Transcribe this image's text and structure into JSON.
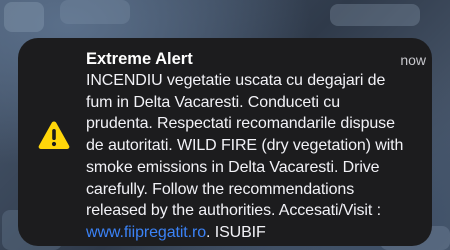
{
  "notification": {
    "title": "Extreme Alert",
    "time": "now",
    "icon": "warning-triangle-icon",
    "icon_color": "#ffd60a",
    "lines": [
      "INCENDIU vegetatie uscata cu degajari de",
      "fum in Delta Vacaresti. Conduceti cu",
      "prudenta. Respectati recomandarile dispuse",
      "de autoritati. WILD FIRE (dry vegetation) with",
      "smoke emissions in Delta Vacaresti. Drive",
      "carefully. Follow the recommendations",
      "released by the authorities. Accesati/Visit :"
    ],
    "link_text": "www.fiipregatit.ro",
    "link_suffix": ". ISUBIF"
  }
}
